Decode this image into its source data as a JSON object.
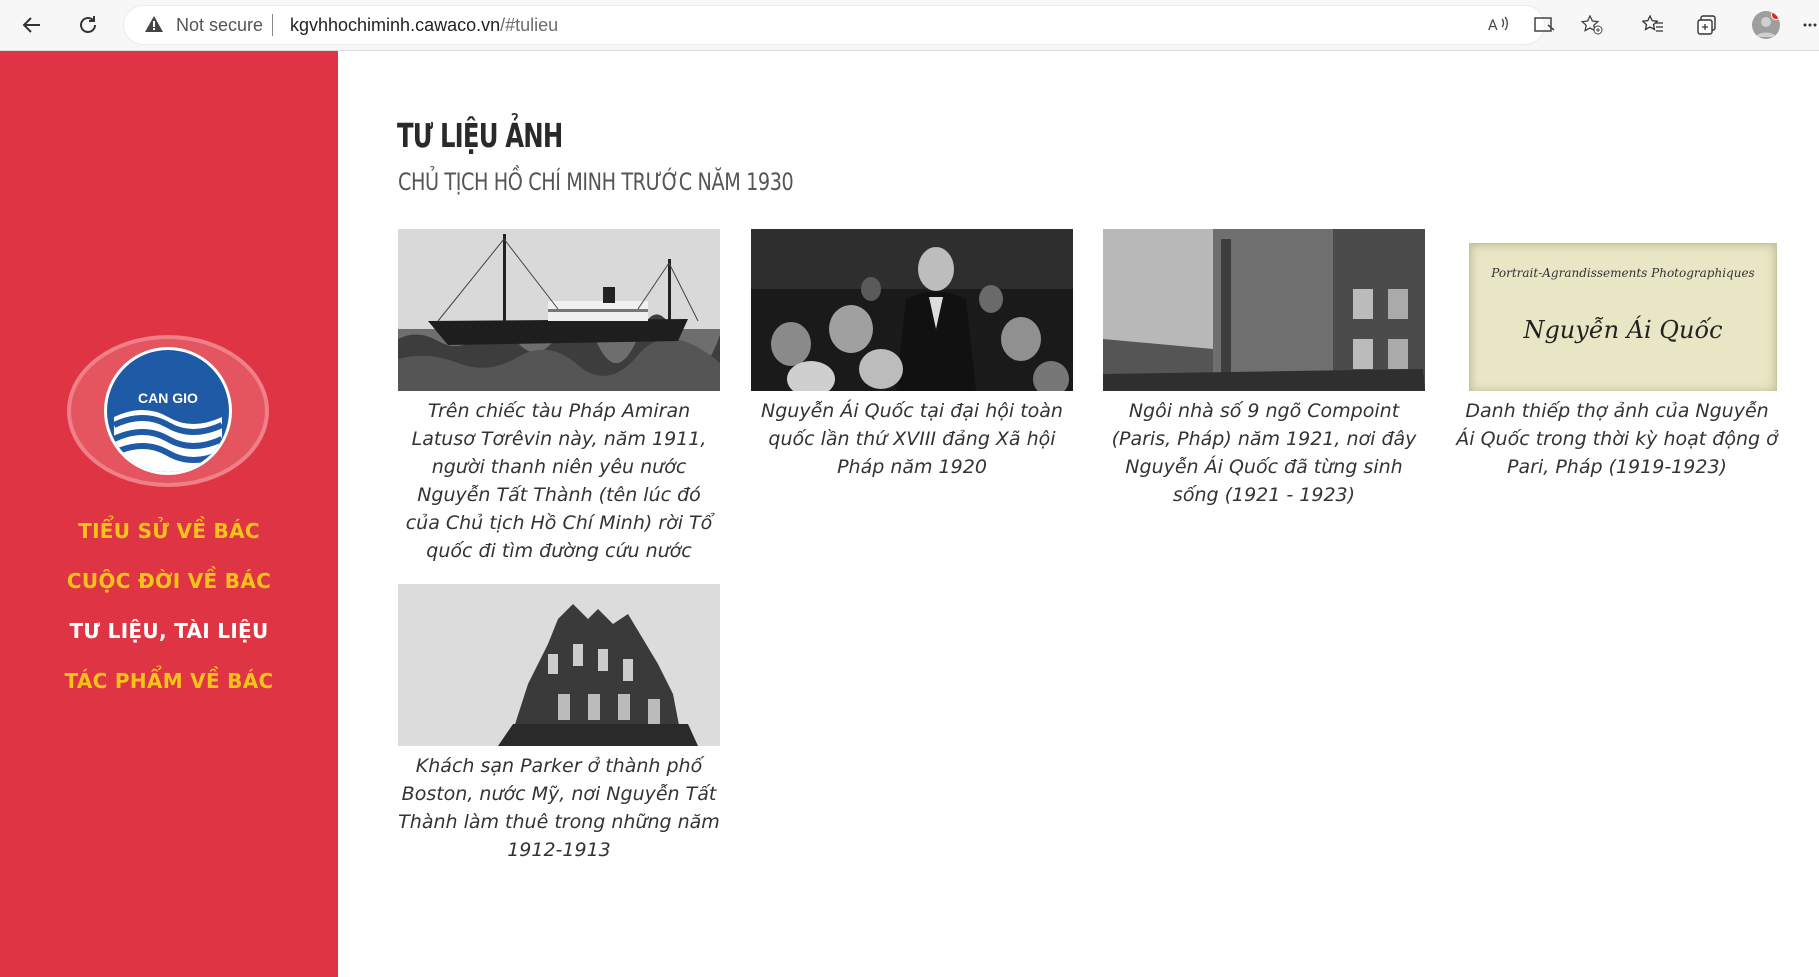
{
  "browser": {
    "security_label": "Not secure",
    "url_host": "kgvhhochiminh.cawaco.vn",
    "url_path": "/#tulieu"
  },
  "sidebar": {
    "logo_text": "CAN GIO",
    "nav": [
      {
        "label": "TIỂU SỬ VỀ BÁC"
      },
      {
        "label": "CUỘC ĐỜI VỀ BÁC"
      },
      {
        "label": "TƯ LIỆU, TÀI LIỆU"
      },
      {
        "label": "TÁC PHẨM VỀ BÁC"
      }
    ]
  },
  "main": {
    "title": "TƯ LIỆU ẢNH",
    "subtitle": "CHỦ TỊCH HỒ CHÍ MINH TRƯỚC NĂM 1930",
    "photos": [
      {
        "caption": "Trên chiếc tàu Pháp Amiran Latusơ Tơrêvin này, năm 1911, người thanh niên yêu nước Nguyễn Tất Thành (tên lúc đó của Chủ tịch Hồ Chí Minh) rời Tổ quốc đi tìm đường cứu nước"
      },
      {
        "caption": "Nguyễn Ái Quốc tại đại hội toàn quốc lần thứ XVIII đảng Xã hội Pháp năm 1920"
      },
      {
        "caption": "Ngôi nhà số 9 ngõ Compoint (Paris, Pháp) năm 1921, nơi đây Nguyễn Ái Quốc đã từng sinh sống (1921 - 1923)"
      },
      {
        "caption": "Danh thiếp thợ ảnh của Nguyễn Ái Quốc trong thời kỳ hoạt động ở Pari, Pháp (1919-1923)",
        "card_line1": "Portrait-Agrandissements Photographiques",
        "card_line2": "Nguyễn Ái Quốc"
      },
      {
        "caption": "Khách sạn Parker ở thành phố Boston, nước Mỹ, nơi Nguyễn Tất Thành làm thuê trong những năm 1912-1913"
      }
    ]
  },
  "colors": {
    "sidebar_bg": "#df3444",
    "nav_color": "#f6c31a",
    "nav_active": "#ffffff"
  }
}
